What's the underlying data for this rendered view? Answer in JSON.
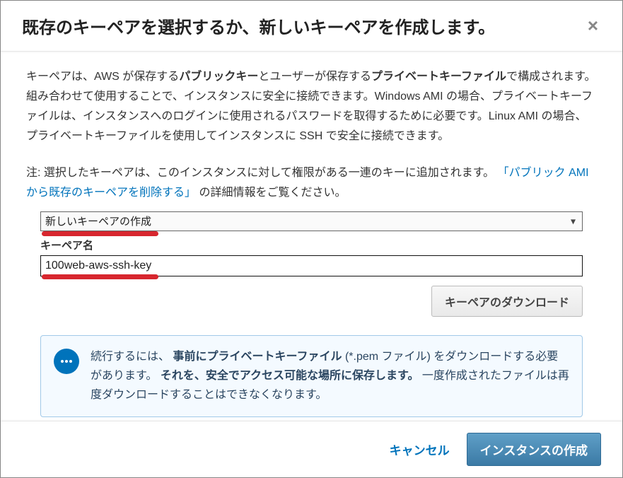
{
  "header": {
    "title": "既存のキーペアを選択するか、新しいキーペアを作成します。"
  },
  "description": {
    "part1": "キーペアは、AWS が保存する",
    "bold1": "パブリックキー",
    "part2": "とユーザーが保存する",
    "bold2": "プライベートキーファイル",
    "part3": "で構成されます。組み合わせて使用することで、インスタンスに安全に接続できます。Windows AMI の場合、プライベートキーファイルは、インスタンスへのログインに使用されるパスワードを取得するために必要です。Linux AMI の場合、プライベートキーファイルを使用してインスタンスに SSH で安全に接続できます。"
  },
  "note": {
    "prefix": "注: 選択したキーペアは、このインスタンスに対して権限がある一連のキーに追加されます。 ",
    "link_open": "「",
    "link_text": "パブリック AMI から既存のキーペアを削除する",
    "link_close": "」",
    "suffix": " の詳細情報をご覧ください。"
  },
  "form": {
    "select_label": "新しいキーペアの作成",
    "name_label": "キーペア名",
    "name_value": "100web-aws-ssh-key",
    "download_button": "キーペアのダウンロード"
  },
  "info": {
    "p1a": "続行するには、 ",
    "p1b_strong": "事前にプライベートキーファイル",
    "p1c": " (*.pem ファイル) をダウンロードする必要があります。 ",
    "p2_strong": "それを、安全でアクセス可能な場所に保存します。",
    "p3": " 一度作成されたファイルは再度ダウンロードすることはできなくなります。"
  },
  "footer": {
    "cancel": "キャンセル",
    "launch": "インスタンスの作成"
  }
}
